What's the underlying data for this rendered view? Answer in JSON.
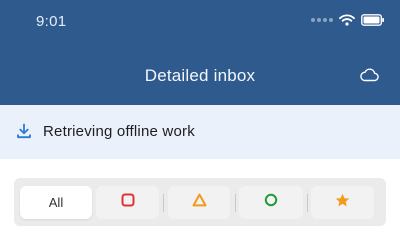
{
  "status_bar": {
    "time": "9:01",
    "signal_icon": "signal-dots-icon",
    "wifi_icon": "wifi-icon",
    "battery_icon": "battery-icon"
  },
  "header": {
    "title": "Detailed inbox",
    "action_icon": "cloud-icon",
    "background": "#2f5a8e"
  },
  "banner": {
    "icon": "download-icon",
    "text": "Retrieving offline work",
    "background": "#eaf1fa",
    "accent": "#2b7bd3"
  },
  "filters": {
    "items": [
      {
        "label": "All",
        "icon": "",
        "selected": true
      },
      {
        "label": "",
        "icon": "red-square-icon",
        "color": "#e0313b"
      },
      {
        "label": "",
        "icon": "orange-triangle-icon",
        "color": "#f29a1a"
      },
      {
        "label": "",
        "icon": "green-circle-icon",
        "color": "#1f9a35"
      },
      {
        "label": "",
        "icon": "orange-star-icon",
        "color": "#f29a1a"
      }
    ]
  }
}
